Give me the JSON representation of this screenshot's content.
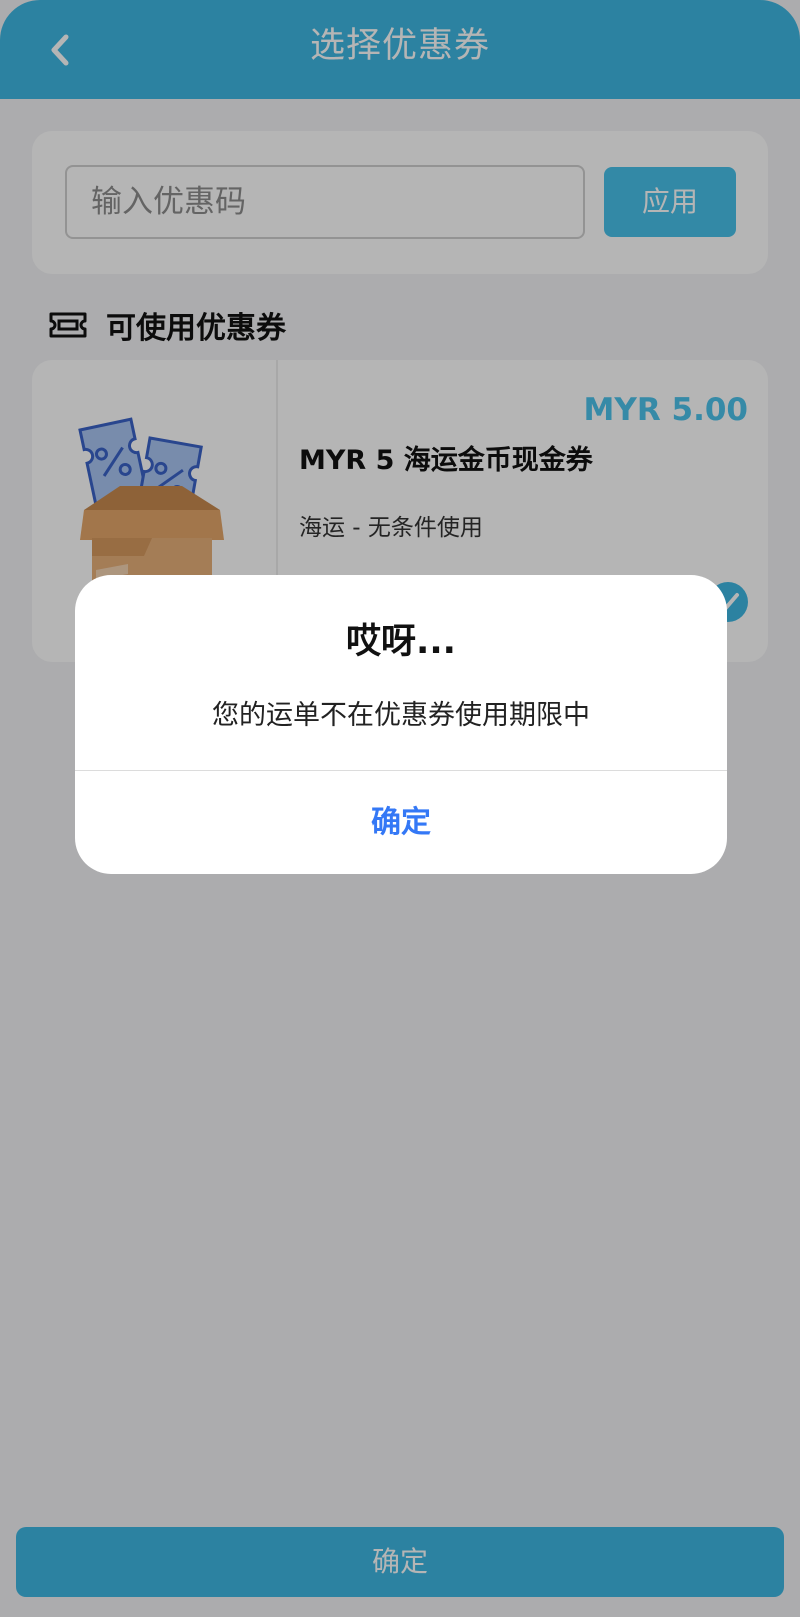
{
  "header": {
    "title": "选择优惠券"
  },
  "promo": {
    "placeholder": "输入优惠码",
    "apply_label": "应用"
  },
  "section": {
    "title": "可使用优惠券"
  },
  "coupon": {
    "amount": "MYR 5.00",
    "title": "MYR 5 海运金币现金券",
    "description": "海运 - 无条件使用",
    "selected": true
  },
  "footer": {
    "confirm_label": "确定"
  },
  "dialog": {
    "title": "哎呀...",
    "message": "您的运单不在优惠券使用期限中",
    "ok_label": "确定"
  },
  "icons": {
    "back": "chevron-left-icon",
    "ticket": "ticket-icon",
    "check": "check-icon"
  },
  "colors": {
    "primary": "#3fb8e3",
    "accent_text": "#4cc3ec",
    "dialog_button": "#3478f6"
  }
}
